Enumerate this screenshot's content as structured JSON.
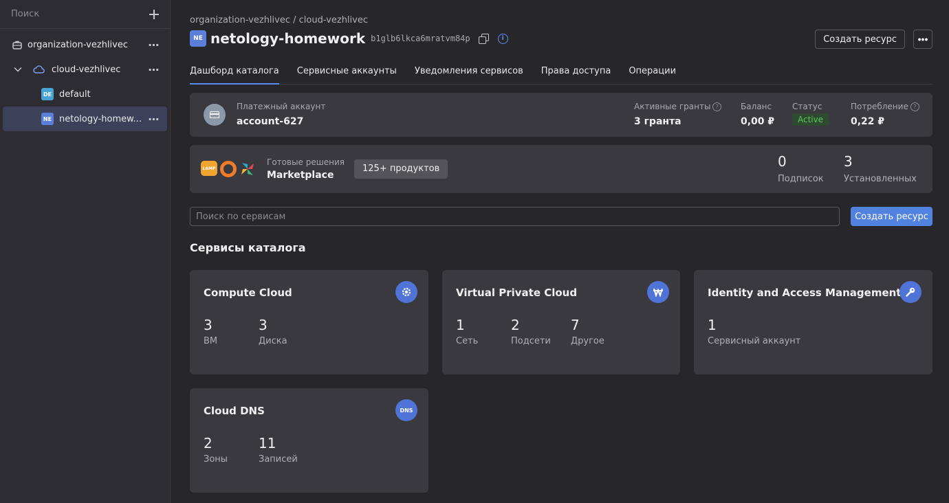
{
  "sidebar": {
    "search_placeholder": "Поиск",
    "items": [
      {
        "label": "organization-vezhlivec",
        "icon": "organization-icon"
      },
      {
        "label": "cloud-vezhlivec",
        "icon": "cloud-icon"
      },
      {
        "label": "default",
        "tag": "DE"
      },
      {
        "label": "netology-homew...",
        "tag": "NE"
      }
    ]
  },
  "header": {
    "breadcrumb": "organization-vezhlivec / cloud-vezhlivec",
    "tag": "NE",
    "title": "netology-homework",
    "folder_id": "b1glb6lkca6mratvm84p",
    "create_button": "Создать ресурс",
    "more_button": "•••"
  },
  "tabs": [
    {
      "label": "Дашборд каталога",
      "active": true
    },
    {
      "label": "Сервисные аккаунты"
    },
    {
      "label": "Уведомления сервисов"
    },
    {
      "label": "Права доступа"
    },
    {
      "label": "Операции"
    }
  ],
  "billing": {
    "account_label": "Платежный аккаунт",
    "account_value": "account-627",
    "grants_label": "Активные гранты",
    "grants_value": "3 гранта",
    "balance_label": "Баланс",
    "balance_value": "0,00 ₽",
    "status_label": "Статус",
    "status_value": "Active",
    "consumption_label": "Потребление",
    "consumption_value": "0,22 ₽"
  },
  "marketplace": {
    "lamp_logo": "LAMP",
    "label": "Готовые решения",
    "title": "Marketplace",
    "chip": "125+ продуктов",
    "subs_value": "0",
    "subs_label": "Подписок",
    "installed_value": "3",
    "installed_label": "Установленных"
  },
  "search": {
    "placeholder": "Поиск по сервисам",
    "button": "Создать ресурс"
  },
  "section_title": "Сервисы каталога",
  "services": [
    {
      "name": "Compute Cloud",
      "icon": "gear-icon",
      "metrics": [
        {
          "n": "3",
          "l": "ВМ"
        },
        {
          "n": "3",
          "l": "Диска"
        }
      ]
    },
    {
      "name": "Virtual Private Cloud",
      "icon": "network-icon",
      "metrics": [
        {
          "n": "1",
          "l": "Сеть"
        },
        {
          "n": "2",
          "l": "Подсети"
        },
        {
          "n": "7",
          "l": "Другое"
        }
      ]
    },
    {
      "name": "Identity and Access Management",
      "icon": "key-icon",
      "metrics": [
        {
          "n": "1",
          "l": "Сервисный аккаунт"
        }
      ]
    },
    {
      "name": "Cloud DNS",
      "icon": "dns-icon",
      "icon_text": "DNS",
      "metrics": [
        {
          "n": "2",
          "l": "Зоны"
        },
        {
          "n": "11",
          "l": "Записей"
        }
      ]
    }
  ],
  "colors": {
    "accent": "#5282e0",
    "status_active": "#5fc35f",
    "background": "#27262b",
    "card": "#3a393f"
  }
}
